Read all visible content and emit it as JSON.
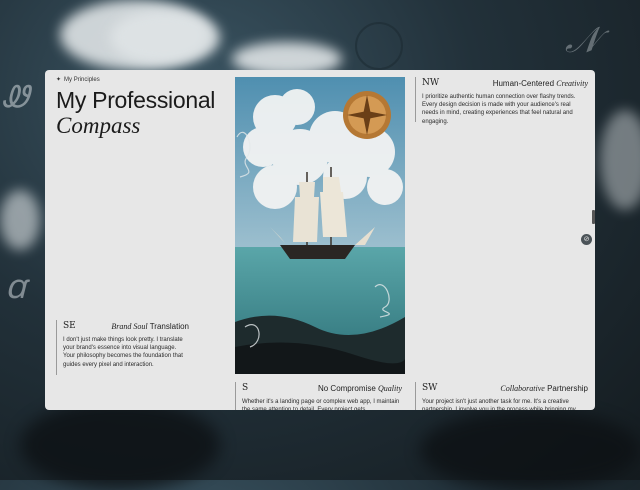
{
  "breadcrumb": {
    "icon": "compass-rose-icon",
    "label": "My Principles"
  },
  "title": {
    "line1": "My Professional",
    "line2": "Compass"
  },
  "cards": [
    {
      "mark": "NW",
      "title_plain": "Human-Centered",
      "title_italic": "Creativity",
      "italic_first": false,
      "body": "I prioritize authentic human connection over flashy trends. Every design decision is made with your audience's real needs in mind, creating experiences that feel natural and engaging."
    },
    {
      "mark": "SE",
      "title_plain": "Translation",
      "title_italic": "Brand Soul",
      "italic_first": true,
      "body": "I don't just make things look pretty. I translate your brand's essence into visual language. Your philosophy becomes the foundation that guides every pixel and interaction."
    },
    {
      "mark": "S",
      "title_plain": "No Compromise",
      "title_italic": "Quality",
      "italic_first": false,
      "body": "Whether it's a landing page or complex web app, I maintain the same attention to detail. Every project gets"
    },
    {
      "mark": "SW",
      "title_plain": "Partnership",
      "title_italic": "Collaborative",
      "italic_first": true,
      "body": "Your project isn't just another task for me. It's a creative partnership. I involve you in the process while bringing my"
    }
  ],
  "image": {
    "alt": "Tall ship sailing under clouds with compass"
  },
  "fab": {
    "icon": "compass-icon"
  },
  "colors": {
    "panel": "#e7e7e7",
    "text": "#1b1b1b",
    "sea": "#3f8f95",
    "sky": "#4f8fb0"
  }
}
